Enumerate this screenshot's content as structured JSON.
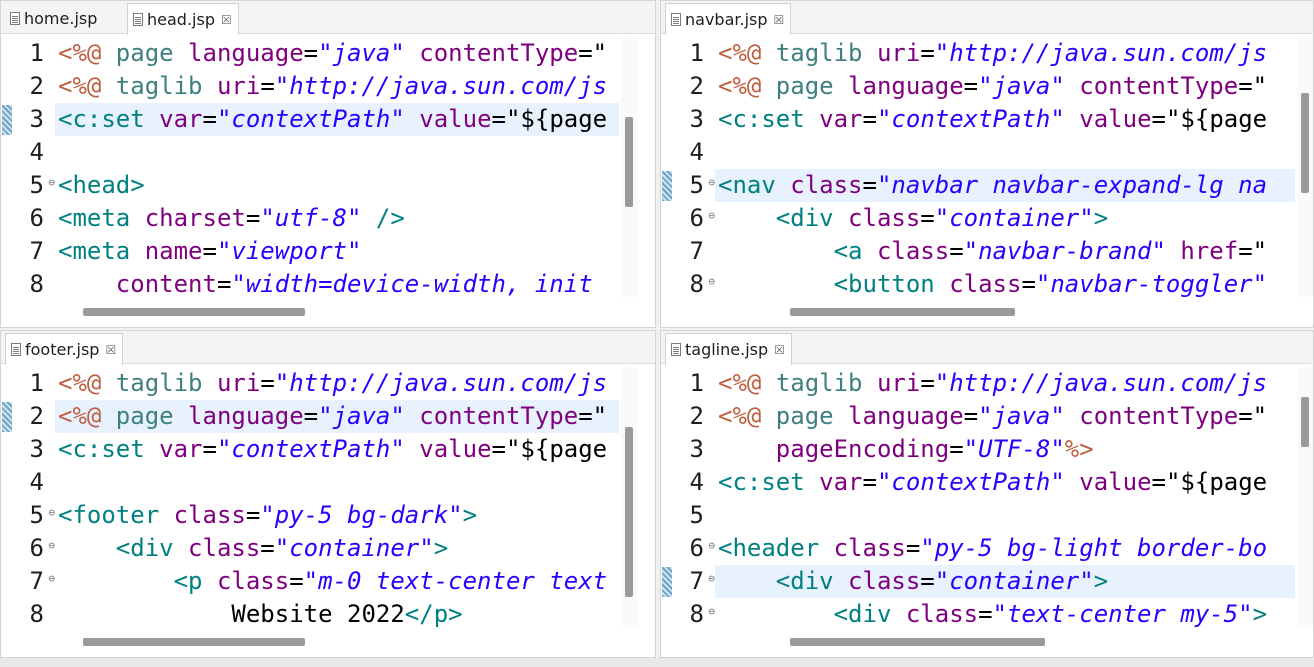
{
  "editors": {
    "top_left": {
      "tabs": [
        {
          "label": "home.jsp",
          "active": false,
          "closable": false
        },
        {
          "label": "head.jsp",
          "active": true,
          "closable": true
        }
      ],
      "lines": [
        {
          "n": "1",
          "parts": [
            [
              "t-jsp",
              "<%@ "
            ],
            [
              "t-kw",
              "page "
            ],
            [
              "t-at",
              "language"
            ],
            [
              "t-p",
              "="
            ],
            [
              "t-str",
              "\"java\" "
            ],
            [
              "t-at",
              "contentType"
            ],
            [
              "t-p",
              "=\""
            ]
          ]
        },
        {
          "n": "2",
          "parts": [
            [
              "t-jsp",
              "<%@ "
            ],
            [
              "t-kw",
              "taglib "
            ],
            [
              "t-at",
              "uri"
            ],
            [
              "t-p",
              "="
            ],
            [
              "t-str",
              "\"http://java.sun.com/js"
            ]
          ]
        },
        {
          "n": "3",
          "hl": true,
          "parts": [
            [
              "t-tag",
              "<c:set "
            ],
            [
              "t-at",
              "var"
            ],
            [
              "t-p",
              "="
            ],
            [
              "t-str",
              "\"contextPath\" "
            ],
            [
              "t-at",
              "value"
            ],
            [
              "t-p",
              "=\"${page"
            ]
          ]
        },
        {
          "n": "4",
          "parts": []
        },
        {
          "n": "5",
          "fold": true,
          "parts": [
            [
              "t-tag",
              "<head>"
            ]
          ]
        },
        {
          "n": "6",
          "parts": [
            [
              "t-tag",
              "<meta "
            ],
            [
              "t-at",
              "charset"
            ],
            [
              "t-p",
              "="
            ],
            [
              "t-str",
              "\"utf-8\" "
            ],
            [
              "t-tag",
              "/>"
            ]
          ]
        },
        {
          "n": "7",
          "parts": [
            [
              "t-tag",
              "<meta "
            ],
            [
              "t-at",
              "name"
            ],
            [
              "t-p",
              "="
            ],
            [
              "t-str",
              "\"viewport\""
            ]
          ]
        },
        {
          "n": "8",
          "parts": [
            [
              "t-p",
              "    "
            ],
            [
              "t-at",
              "content"
            ],
            [
              "t-p",
              "="
            ],
            [
              "t-str",
              "\"width=device-width, init"
            ]
          ]
        }
      ]
    },
    "top_right": {
      "tabs": [
        {
          "label": "navbar.jsp",
          "active": true,
          "closable": true
        }
      ],
      "lines": [
        {
          "n": "1",
          "parts": [
            [
              "t-jsp",
              "<%@ "
            ],
            [
              "t-kw",
              "taglib "
            ],
            [
              "t-at",
              "uri"
            ],
            [
              "t-p",
              "="
            ],
            [
              "t-str",
              "\"http://java.sun.com/js"
            ]
          ]
        },
        {
          "n": "2",
          "parts": [
            [
              "t-jsp",
              "<%@ "
            ],
            [
              "t-kw",
              "page "
            ],
            [
              "t-at",
              "language"
            ],
            [
              "t-p",
              "="
            ],
            [
              "t-str",
              "\"java\" "
            ],
            [
              "t-at",
              "contentType"
            ],
            [
              "t-p",
              "=\""
            ]
          ]
        },
        {
          "n": "3",
          "parts": [
            [
              "t-tag",
              "<c:set "
            ],
            [
              "t-at",
              "var"
            ],
            [
              "t-p",
              "="
            ],
            [
              "t-str",
              "\"contextPath\" "
            ],
            [
              "t-at",
              "value"
            ],
            [
              "t-p",
              "=\"${page"
            ]
          ]
        },
        {
          "n": "4",
          "parts": []
        },
        {
          "n": "5",
          "hl": true,
          "fold": true,
          "parts": [
            [
              "t-tag",
              "<nav "
            ],
            [
              "t-at",
              "class"
            ],
            [
              "t-p",
              "="
            ],
            [
              "t-str",
              "\"navbar navbar-expand-lg na"
            ]
          ]
        },
        {
          "n": "6",
          "fold": true,
          "parts": [
            [
              "t-p",
              "    "
            ],
            [
              "t-tag",
              "<div "
            ],
            [
              "t-at",
              "class"
            ],
            [
              "t-p",
              "="
            ],
            [
              "t-str",
              "\"container\""
            ],
            [
              "t-tag",
              ">"
            ]
          ]
        },
        {
          "n": "7",
          "parts": [
            [
              "t-p",
              "        "
            ],
            [
              "t-tag",
              "<a "
            ],
            [
              "t-at",
              "class"
            ],
            [
              "t-p",
              "="
            ],
            [
              "t-str",
              "\"navbar-brand\" "
            ],
            [
              "t-at",
              "href"
            ],
            [
              "t-p",
              "=\""
            ]
          ]
        },
        {
          "n": "8",
          "fold": true,
          "parts": [
            [
              "t-p",
              "        "
            ],
            [
              "t-tag",
              "<button "
            ],
            [
              "t-at",
              "class"
            ],
            [
              "t-p",
              "="
            ],
            [
              "t-str",
              "\"navbar-toggler\""
            ]
          ]
        }
      ]
    },
    "bottom_left": {
      "tabs": [
        {
          "label": "footer.jsp",
          "active": true,
          "closable": true
        }
      ],
      "lines": [
        {
          "n": "1",
          "parts": [
            [
              "t-jsp",
              "<%@ "
            ],
            [
              "t-kw",
              "taglib "
            ],
            [
              "t-at",
              "uri"
            ],
            [
              "t-p",
              "="
            ],
            [
              "t-str",
              "\"http://java.sun.com/js"
            ]
          ]
        },
        {
          "n": "2",
          "hl": true,
          "parts": [
            [
              "t-jsp",
              "<%@ "
            ],
            [
              "t-kw",
              "page "
            ],
            [
              "t-at",
              "language"
            ],
            [
              "t-p",
              "="
            ],
            [
              "t-str",
              "\"java\" "
            ],
            [
              "t-at",
              "contentType"
            ],
            [
              "t-p",
              "=\""
            ]
          ]
        },
        {
          "n": "3",
          "parts": [
            [
              "t-tag",
              "<c:set "
            ],
            [
              "t-at",
              "var"
            ],
            [
              "t-p",
              "="
            ],
            [
              "t-str",
              "\"contextPath\" "
            ],
            [
              "t-at",
              "value"
            ],
            [
              "t-p",
              "=\"${page"
            ]
          ]
        },
        {
          "n": "4",
          "parts": []
        },
        {
          "n": "5",
          "fold": true,
          "parts": [
            [
              "t-tag",
              "<footer "
            ],
            [
              "t-at",
              "class"
            ],
            [
              "t-p",
              "="
            ],
            [
              "t-str",
              "\"py-5 bg-dark\""
            ],
            [
              "t-tag",
              ">"
            ]
          ]
        },
        {
          "n": "6",
          "fold": true,
          "parts": [
            [
              "t-p",
              "    "
            ],
            [
              "t-tag",
              "<div "
            ],
            [
              "t-at",
              "class"
            ],
            [
              "t-p",
              "="
            ],
            [
              "t-str",
              "\"container\""
            ],
            [
              "t-tag",
              ">"
            ]
          ]
        },
        {
          "n": "7",
          "fold": true,
          "parts": [
            [
              "t-p",
              "        "
            ],
            [
              "t-tag",
              "<p "
            ],
            [
              "t-at",
              "class"
            ],
            [
              "t-p",
              "="
            ],
            [
              "t-str",
              "\"m-0 text-center text"
            ]
          ]
        },
        {
          "n": "8",
          "parts": [
            [
              "t-p",
              "            "
            ],
            [
              "squig",
              "Website"
            ],
            [
              "t-p",
              " 2022"
            ],
            [
              "t-tag",
              "</p>"
            ]
          ]
        }
      ]
    },
    "bottom_right": {
      "tabs": [
        {
          "label": "tagline.jsp",
          "active": true,
          "closable": true
        }
      ],
      "lines": [
        {
          "n": "1",
          "parts": [
            [
              "t-jsp",
              "<%@ "
            ],
            [
              "t-kw",
              "taglib "
            ],
            [
              "t-at",
              "uri"
            ],
            [
              "t-p",
              "="
            ],
            [
              "t-str",
              "\"http://java.sun.com/js"
            ]
          ]
        },
        {
          "n": "2",
          "parts": [
            [
              "t-jsp",
              "<%@ "
            ],
            [
              "t-kw",
              "page "
            ],
            [
              "t-at",
              "language"
            ],
            [
              "t-p",
              "="
            ],
            [
              "t-str",
              "\"java\" "
            ],
            [
              "t-at",
              "contentType"
            ],
            [
              "t-p",
              "=\""
            ]
          ]
        },
        {
          "n": "3",
          "parts": [
            [
              "t-p",
              "    "
            ],
            [
              "t-at",
              "pageEncoding"
            ],
            [
              "t-p",
              "="
            ],
            [
              "t-str",
              "\"UTF-8\""
            ],
            [
              "t-jsp",
              "%>"
            ]
          ]
        },
        {
          "n": "4",
          "parts": [
            [
              "t-tag",
              "<c:set "
            ],
            [
              "t-at",
              "var"
            ],
            [
              "t-p",
              "="
            ],
            [
              "t-str",
              "\"contextPath\" "
            ],
            [
              "t-at",
              "value"
            ],
            [
              "t-p",
              "=\"${page"
            ]
          ]
        },
        {
          "n": "5",
          "parts": []
        },
        {
          "n": "6",
          "fold": true,
          "parts": [
            [
              "t-tag",
              "<header "
            ],
            [
              "t-at",
              "class"
            ],
            [
              "t-p",
              "="
            ],
            [
              "t-str",
              "\"py-5 bg-light border-bo"
            ]
          ]
        },
        {
          "n": "7",
          "hl": true,
          "fold": true,
          "parts": [
            [
              "t-p",
              "    "
            ],
            [
              "t-tag",
              "<div "
            ],
            [
              "t-at",
              "class"
            ],
            [
              "t-p",
              "="
            ],
            [
              "t-str",
              "\"container\""
            ],
            [
              "t-tag",
              ">"
            ]
          ]
        },
        {
          "n": "8",
          "fold": true,
          "parts": [
            [
              "t-p",
              "        "
            ],
            [
              "t-tag",
              "<div "
            ],
            [
              "t-at",
              "class"
            ],
            [
              "t-p",
              "="
            ],
            [
              "t-str",
              "\"text-center my-5\""
            ],
            [
              "t-tag",
              ">"
            ]
          ]
        }
      ]
    }
  }
}
